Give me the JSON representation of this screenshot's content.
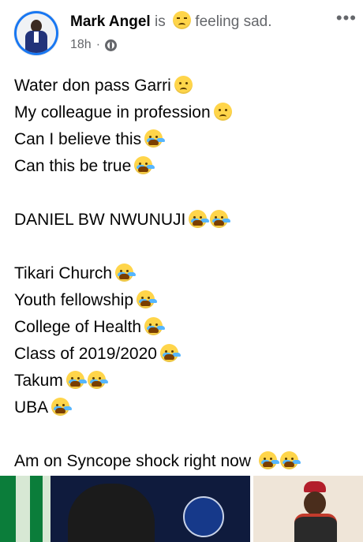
{
  "post": {
    "author_name": "Mark Angel",
    "feeling_prefix": "is",
    "feeling_text": "feeling sad.",
    "feeling_icon": "disappointed-face-icon",
    "time": "18h",
    "separator": "·",
    "audience_icon": "globe-icon",
    "more_label": "•••"
  },
  "content": {
    "lines": [
      {
        "text": "Water don pass Garri",
        "emoji": [
          "sad-face"
        ]
      },
      {
        "text": "My colleague in profession",
        "emoji": [
          "sad-face"
        ]
      },
      {
        "text": "Can I believe this",
        "emoji": [
          "crying-face"
        ]
      },
      {
        "text": "Can this be true",
        "emoji": [
          "crying-face"
        ]
      },
      {
        "text": "",
        "emoji": []
      },
      {
        "text": "DANIEL BW NWUNUJI",
        "emoji": [
          "crying-face",
          "crying-face"
        ]
      },
      {
        "text": "",
        "emoji": []
      },
      {
        "text": "Tikari Church",
        "emoji": [
          "crying-face"
        ]
      },
      {
        "text": "Youth fellowship",
        "emoji": [
          "crying-face"
        ]
      },
      {
        "text": "College of Health",
        "emoji": [
          "crying-face"
        ]
      },
      {
        "text": "Class of 2019/2020",
        "emoji": [
          "crying-face"
        ]
      },
      {
        "text": "Takum",
        "emoji": [
          "crying-face",
          "crying-face"
        ]
      },
      {
        "text": "UBA",
        "emoji": [
          "crying-face"
        ]
      },
      {
        "text": "",
        "emoji": []
      },
      {
        "text": "Am on Syncope shock right now ",
        "emoji": [
          "crying-face",
          "crying-face"
        ]
      }
    ]
  },
  "colors": {
    "text": "#050505",
    "muted": "#65676b",
    "accent": "#1877f2"
  }
}
